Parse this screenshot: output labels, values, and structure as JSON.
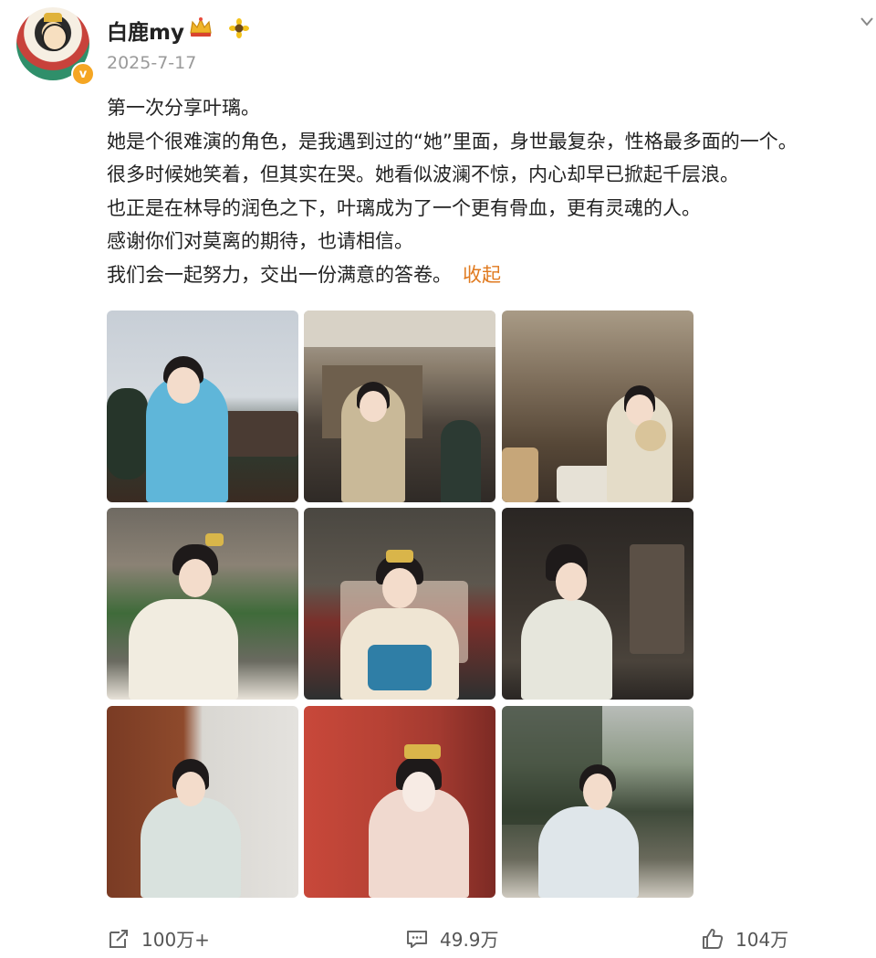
{
  "user": {
    "name": "白鹿my",
    "timestamp": "2025-7-17",
    "verified_badge": "v"
  },
  "post": {
    "lines": [
      "第一次分享叶璃。",
      "她是个很难演的角色，是我遇到过的“她”里面，身世最复杂，性格最多面的一个。",
      "很多时候她笑着，但其实在哭。她看似波澜不惊，内心却早已掀起千层浪。",
      "也正是在林导的润色之下，叶璃成为了一个更有骨血，更有灵魂的人。",
      "感谢你们对莫离的期待，也请相信。",
      "我们会一起努力，交出一份满意的答卷。"
    ],
    "collapse_label": "收起"
  },
  "photos": [
    {
      "name": "photo-1"
    },
    {
      "name": "photo-2"
    },
    {
      "name": "photo-3"
    },
    {
      "name": "photo-4"
    },
    {
      "name": "photo-5"
    },
    {
      "name": "photo-6"
    },
    {
      "name": "photo-7"
    },
    {
      "name": "photo-8"
    },
    {
      "name": "photo-9"
    }
  ],
  "actions": {
    "repost_count": "100万+",
    "comment_count": "49.9万",
    "like_count": "104万"
  },
  "colors": {
    "link_orange": "#e07a1f",
    "timestamp_gray": "#9a9a9a",
    "badge_orange": "#f5a623"
  }
}
